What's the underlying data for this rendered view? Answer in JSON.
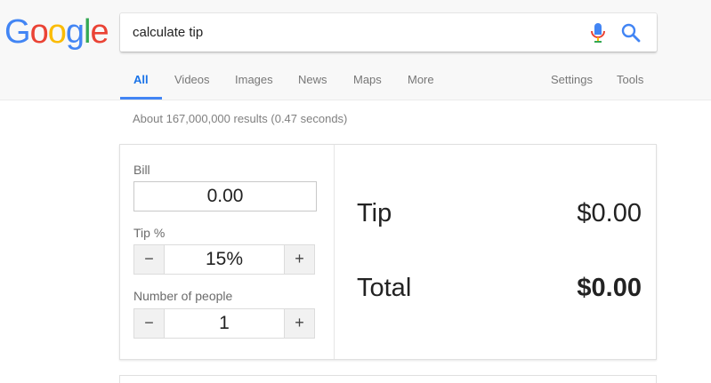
{
  "logo": {
    "letters": [
      "G",
      "o",
      "o",
      "g",
      "l",
      "e"
    ],
    "colors": [
      "#4285F4",
      "#EA4335",
      "#FBBC05",
      "#4285F4",
      "#34A853",
      "#EA4335"
    ]
  },
  "search": {
    "query": "calculate tip",
    "mic_icon": "mic-icon",
    "search_icon": "search-icon"
  },
  "tabs": {
    "all": "All",
    "videos": "Videos",
    "images": "Images",
    "news": "News",
    "maps": "Maps",
    "more": "More",
    "settings": "Settings",
    "tools": "Tools",
    "active": "All",
    "accent": "#4285f4"
  },
  "result_stats": "About 167,000,000 results (0.47 seconds)",
  "calculator": {
    "bill_label": "Bill",
    "bill_value": "0.00",
    "tip_label": "Tip %",
    "tip_value": "15%",
    "people_label": "Number of people",
    "people_value": "1",
    "minus": "−",
    "plus": "+",
    "tip_result_label": "Tip",
    "tip_result_value": "$0.00",
    "total_label": "Total",
    "total_value": "$0.00"
  }
}
